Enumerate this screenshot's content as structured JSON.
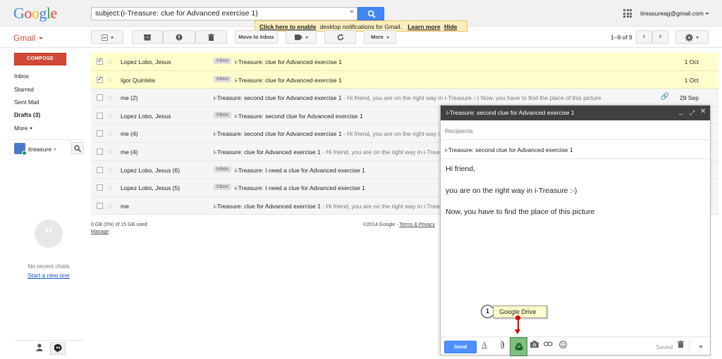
{
  "header": {
    "logo": [
      "G",
      "o",
      "o",
      "g",
      "l",
      "e"
    ],
    "search_value": "subject:(i-Treasure: clue for Advanced exercise 1)",
    "account": "itreasureag@gmail.com"
  },
  "notification": {
    "link": "Click here to enable",
    "text": "desktop notifications for Gmail.",
    "learn": "Learn more",
    "hide": "Hide"
  },
  "app": {
    "name": "Gmail"
  },
  "toolbar": {
    "move_to_inbox": "Move to Inbox",
    "more": "More",
    "page_info": "1–9 of 9"
  },
  "sidebar": {
    "compose": "COMPOSE",
    "items": [
      "Inbox",
      "Starred",
      "Sent Mail",
      "Drafts (3)",
      "More"
    ],
    "user": "itreasure",
    "no_chats": "No recent chats",
    "start_new": "Start a new one"
  },
  "emails": [
    {
      "sender": "Lopez Lobo, Jesus",
      "label": "Inbox",
      "subject": "i-Treasure: clue for Advanced exercise 1",
      "snippet": "",
      "date": "1 Oct",
      "selected": true
    },
    {
      "sender": "Igor Quintela",
      "label": "Inbox",
      "subject": "i-Treasure: clue for Advanced exercise 1",
      "snippet": "",
      "date": "1 Oct",
      "selected": true
    },
    {
      "sender": "me (2)",
      "label": "",
      "subject": "i-Treasure: second clue for Advanced exercise 1",
      "snippet": " - Hi friend, you are on the right way in i-Treasure :-) Now, you have to find the place of this picture",
      "date": "29 Sep",
      "selected": false
    },
    {
      "sender": "Lopez Lobo, Jesus",
      "label": "Inbox",
      "subject": "i-Treasure: second clue for Advanced exercise 1",
      "snippet": "",
      "date": "",
      "selected": false
    },
    {
      "sender": "me (4)",
      "label": "",
      "subject": "i-Treasure: second clue for Advanced exercise 1",
      "snippet": " - Hi friend, you are on the right way in i-Treasure",
      "date": "",
      "selected": false
    },
    {
      "sender": "me (4)",
      "label": "",
      "subject": "i-Treasure: clue for Advanced exercise 1",
      "snippet": " - Hi friend, you are on the right way in i-Treasure",
      "date": "",
      "selected": false
    },
    {
      "sender": "Lopez Lobo, Jesus (6)",
      "label": "Inbox",
      "subject": "i-Treasure: I need a clue for Advanced exercise 1",
      "snippet": "",
      "date": "",
      "selected": false
    },
    {
      "sender": "Lopez Lobo, Jesus (5)",
      "label": "Inbox",
      "subject": "i-Treasure: I need a clue for Advanced exercise 1",
      "snippet": "",
      "date": "",
      "selected": false
    },
    {
      "sender": "me",
      "label": "",
      "subject": "i-Treasure: clue for Advanced exercise 1",
      "snippet": " - Hi friend, you are on the right way in i-Treasure",
      "date": "",
      "selected": false
    }
  ],
  "footer": {
    "storage": "0 GB (0%) of 15 GB used",
    "manage": "Manage",
    "copyright": "©2014 Google - ",
    "terms": "Terms & Privacy"
  },
  "compose_window": {
    "title": "i-Treasure: second clue for Advanced exercise 1",
    "recipients_placeholder": "Recipients",
    "subject": "i-Treasure: second clue for Advanced exercise 1",
    "body": [
      "Hi friend,",
      "you are on the right way in i-Treasure :-)",
      "Now, you have to find the place of this picture"
    ],
    "send": "Send",
    "saved": "Saved"
  },
  "callout": {
    "number": "1",
    "text": "Google Drive"
  }
}
